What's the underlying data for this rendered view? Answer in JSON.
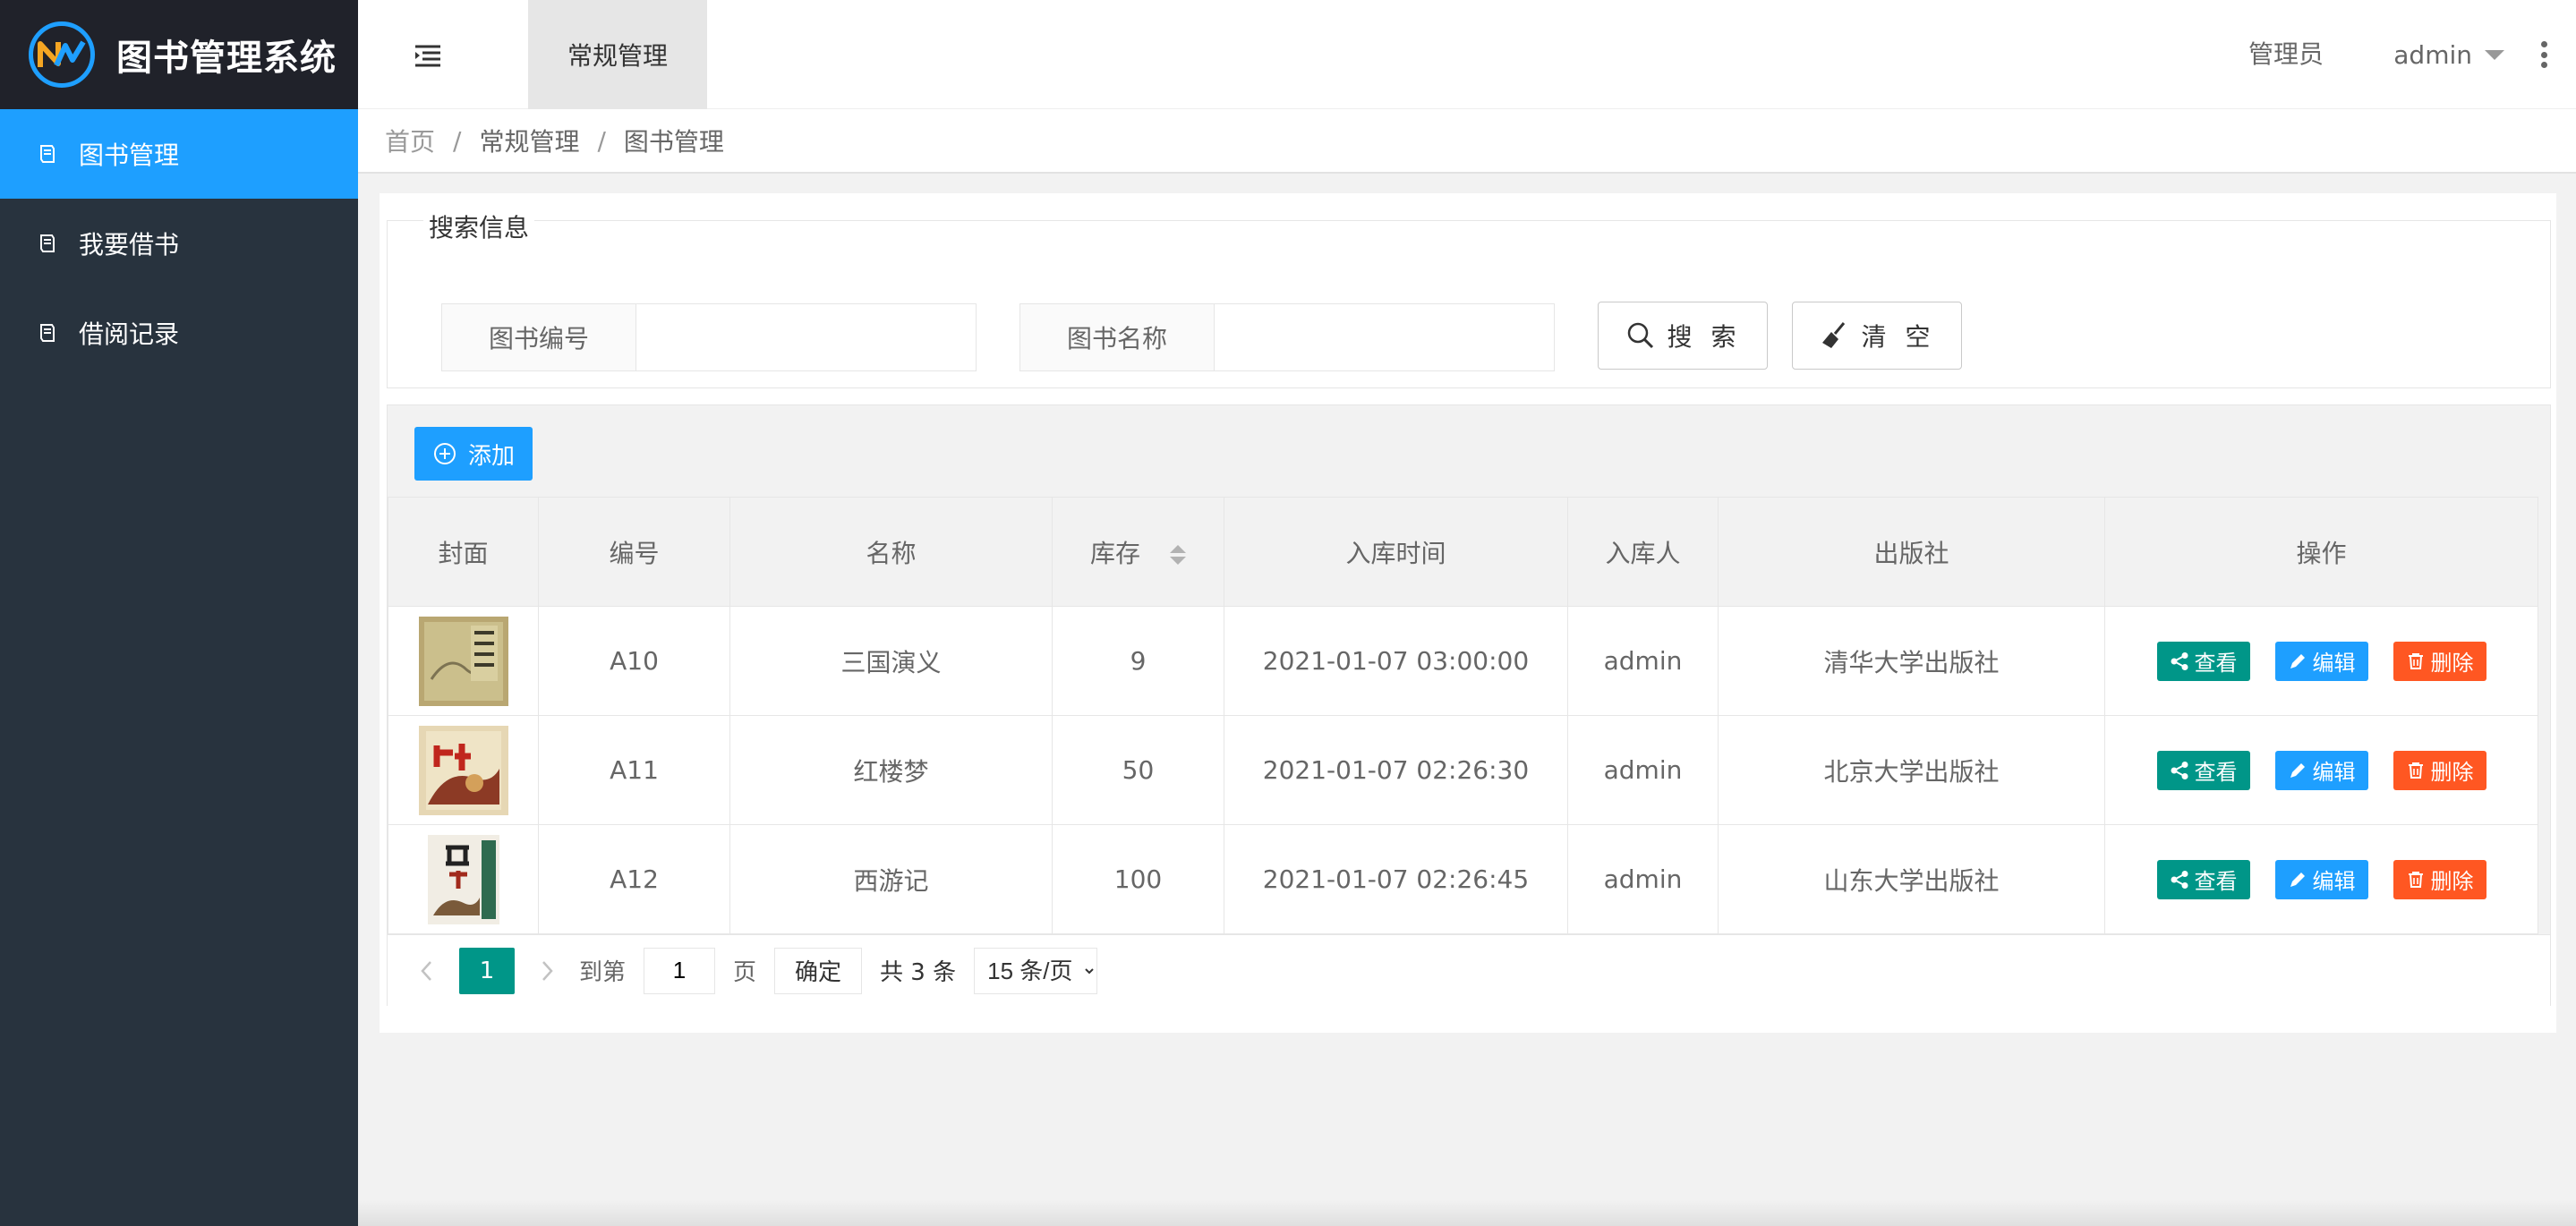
{
  "app": {
    "title": "图书管理系统"
  },
  "sidebar": {
    "items": [
      {
        "label": "图书管理",
        "icon": "book-icon",
        "active": true
      },
      {
        "label": "我要借书",
        "icon": "book-icon",
        "active": false
      },
      {
        "label": "借阅记录",
        "icon": "book-icon",
        "active": false
      }
    ]
  },
  "header": {
    "tab": "常规管理",
    "role": "管理员",
    "user": "admin"
  },
  "breadcrumb": [
    "首页",
    "常规管理",
    "图书管理"
  ],
  "search": {
    "legend": "搜索信息",
    "fields": [
      {
        "label": "图书编号",
        "value": ""
      },
      {
        "label": "图书名称",
        "value": ""
      }
    ],
    "search_button": "搜 索",
    "clear_button": "清 空"
  },
  "toolbar": {
    "add_label": "添加"
  },
  "table": {
    "columns": [
      "封面",
      "编号",
      "名称",
      "库存",
      "入库时间",
      "入库人",
      "出版社",
      "操作"
    ],
    "rows": [
      {
        "cover": "三国演义",
        "id": "A10",
        "name": "三国演义",
        "stock": "9",
        "time": "2021-01-07 03:00:00",
        "operator": "admin",
        "publisher": "清华大学出版社"
      },
      {
        "cover": "红楼梦",
        "id": "A11",
        "name": "红楼梦",
        "stock": "50",
        "time": "2021-01-07 02:26:30",
        "operator": "admin",
        "publisher": "北京大学出版社"
      },
      {
        "cover": "西游记",
        "id": "A12",
        "name": "西游记",
        "stock": "100",
        "time": "2021-01-07 02:26:45",
        "operator": "admin",
        "publisher": "山东大学出版社"
      }
    ],
    "actions": {
      "view": "查看",
      "edit": "编辑",
      "delete": "删除"
    }
  },
  "pager": {
    "current": "1",
    "goto_prefix": "到第",
    "goto_value": "1",
    "goto_suffix": "页",
    "confirm": "确定",
    "total": "共 3 条",
    "page_size": "15 条/页"
  },
  "colors": {
    "sidebar_bg": "#28333e",
    "logo_bg": "#20222a",
    "accent_blue": "#1e9fff",
    "accent_green": "#009688",
    "danger": "#ff5722"
  }
}
